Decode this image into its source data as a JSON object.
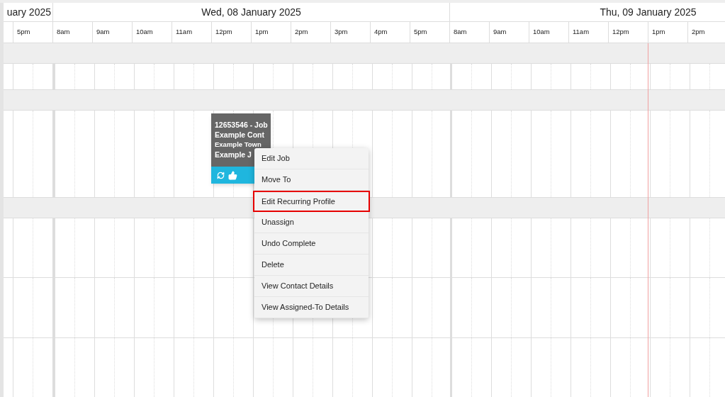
{
  "days": [
    {
      "kind": "partial",
      "title": "uary 2025",
      "hours": [
        "5pm"
      ]
    },
    {
      "kind": "full",
      "title": "Wed, 08 January 2025",
      "hours": [
        "8am",
        "9am",
        "10am",
        "11am",
        "12pm",
        "1pm",
        "2pm",
        "3pm",
        "4pm",
        "5pm"
      ]
    },
    {
      "kind": "full",
      "title": "Thu, 09 January 2025",
      "hours": [
        "8am",
        "9am",
        "10am",
        "11am",
        "12pm",
        "1pm",
        "2pm"
      ]
    }
  ],
  "job": {
    "lines": [
      "12653546 - Job",
      "Example Cont",
      "Example Town",
      "Example J"
    ]
  },
  "context_menu": {
    "items": [
      {
        "label": "Edit Job",
        "highlighted": false
      },
      {
        "label": "Move To",
        "highlighted": false
      },
      {
        "label": "Edit Recurring Profile",
        "highlighted": true
      },
      {
        "label": "Unassign",
        "highlighted": false
      },
      {
        "label": "Undo Complete",
        "highlighted": false
      },
      {
        "label": "Delete",
        "highlighted": false
      },
      {
        "label": "View Contact Details",
        "highlighted": false
      },
      {
        "label": "View Assigned-To Details",
        "highlighted": false
      }
    ]
  }
}
